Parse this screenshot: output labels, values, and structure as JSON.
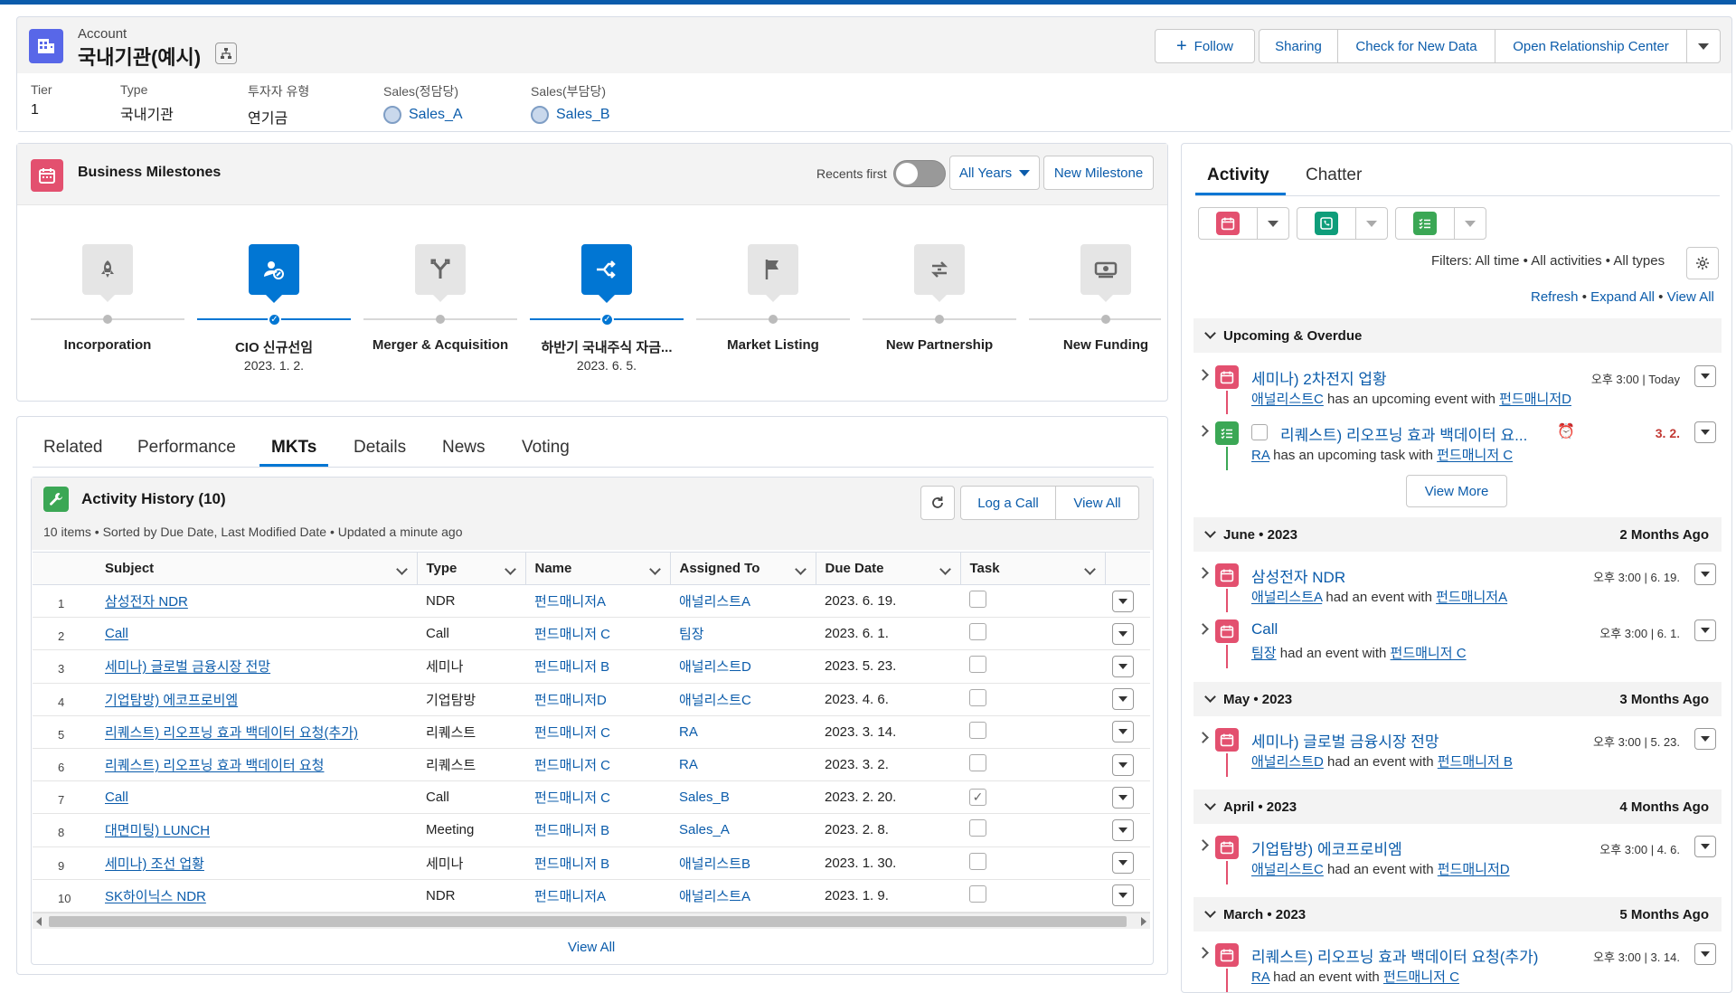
{
  "header": {
    "object_label": "Account",
    "record_name": "국내기관(예시)",
    "buttons": {
      "follow": "Follow",
      "sharing": "Sharing",
      "check_new_data": "Check for New Data",
      "open_relationship_center": "Open Relationship Center"
    },
    "fields": [
      {
        "label": "Tier",
        "value": "1"
      },
      {
        "label": "Type",
        "value": "국내기관"
      },
      {
        "label": "투자자 유형",
        "value": "연기금"
      },
      {
        "label": "Sales(정담당)",
        "value": "Sales_A"
      },
      {
        "label": "Sales(부담당)",
        "value": "Sales_B"
      }
    ]
  },
  "milestones": {
    "title": "Business Milestones",
    "recents_first_label": "Recents first",
    "recents_first_on": false,
    "years_filter": "All Years",
    "new_button": "New Milestone",
    "items": [
      {
        "label": "Incorporation",
        "date": "",
        "active": false,
        "icon": "rocket-icon"
      },
      {
        "label": "CIO 신규선임",
        "date": "2023. 1. 2.",
        "active": true,
        "icon": "user-edit-icon"
      },
      {
        "label": "Merger & Acquisition",
        "date": "",
        "active": false,
        "icon": "merge-icon"
      },
      {
        "label": "하반기 국내주식 자금...",
        "date": "2023. 6. 5.",
        "active": true,
        "icon": "split-arrows-icon"
      },
      {
        "label": "Market Listing",
        "date": "",
        "active": false,
        "icon": "flag-icon"
      },
      {
        "label": "New Partnership",
        "date": "",
        "active": false,
        "icon": "swap-icon"
      },
      {
        "label": "New Funding",
        "date": "",
        "active": false,
        "icon": "cash-icon"
      }
    ]
  },
  "tabs": [
    "Related",
    "Performance",
    "MKTs",
    "Details",
    "News",
    "Voting"
  ],
  "active_tab": "MKTs",
  "activity_history": {
    "title": "Activity History (10)",
    "subtitle": "10 items • Sorted by Due Date, Last Modified Date • Updated a minute ago",
    "log_call": "Log a Call",
    "view_all": "View All",
    "footer_view_all": "View All",
    "columns": [
      "Subject",
      "Type",
      "Name",
      "Assigned To",
      "Due Date",
      "Task"
    ],
    "rows": [
      {
        "n": "1",
        "subject": "삼성전자 NDR",
        "type": "NDR",
        "name": "펀드매니저A",
        "assigned": "애널리스트A",
        "due": "2023. 6. 19.",
        "task": false
      },
      {
        "n": "2",
        "subject": "Call",
        "type": "Call",
        "name": "펀드매니저 C",
        "assigned": "팀장",
        "due": "2023. 6. 1.",
        "task": false
      },
      {
        "n": "3",
        "subject": "세미나) 글로벌 금융시장 전망",
        "type": "세미나",
        "name": "펀드매니저 B",
        "assigned": "애널리스트D",
        "due": "2023. 5. 23.",
        "task": false
      },
      {
        "n": "4",
        "subject": "기업탐방) 에코프로비엠",
        "type": "기업탐방",
        "name": "펀드매니저D",
        "assigned": "애널리스트C",
        "due": "2023. 4. 6.",
        "task": false
      },
      {
        "n": "5",
        "subject": "리퀘스트) 리오프닝 효과 백데이터 요청(추가)",
        "type": "리퀘스트",
        "name": "펀드매니저 C",
        "assigned": "RA",
        "due": "2023. 3. 14.",
        "task": false
      },
      {
        "n": "6",
        "subject": "리퀘스트) 리오프닝 효과 백데이터 요청",
        "type": "리퀘스트",
        "name": "펀드매니저 C",
        "assigned": "RA",
        "due": "2023. 3. 2.",
        "task": false
      },
      {
        "n": "7",
        "subject": "Call",
        "type": "Call",
        "name": "펀드매니저 C",
        "assigned": "Sales_B",
        "due": "2023. 2. 20.",
        "task": true
      },
      {
        "n": "8",
        "subject": "대면미팅) LUNCH",
        "type": "Meeting",
        "name": "펀드매니저 B",
        "assigned": "Sales_A",
        "due": "2023. 2. 8.",
        "task": false
      },
      {
        "n": "9",
        "subject": "세미나) 조선 업황",
        "type": "세미나",
        "name": "펀드매니저 B",
        "assigned": "애널리스트B",
        "due": "2023. 1. 30.",
        "task": false
      },
      {
        "n": "10",
        "subject": "SK하이닉스 NDR",
        "type": "NDR",
        "name": "펀드매니저A",
        "assigned": "애널리스트A",
        "due": "2023. 1. 9.",
        "task": false
      }
    ]
  },
  "activity": {
    "tabs": [
      "Activity",
      "Chatter"
    ],
    "filters_text": "Filters: All time • All activities • All types",
    "refresh": "Refresh",
    "expand_all": "Expand All",
    "view_all": "View All",
    "view_more": "View More",
    "upcoming_title": "Upcoming & Overdue",
    "upcoming": [
      {
        "subject": "세미나) 2차전지 업황",
        "who": "애널리스트C",
        "verb": "has an upcoming event with",
        "whom": "펀드매니저D",
        "time": "오후 3:00 | Today",
        "kind": "event"
      },
      {
        "subject": "리퀘스트) 리오프닝 효과 백데이터 요...",
        "who": "RA",
        "verb": "has an upcoming task with",
        "whom": "펀드매니저 C",
        "time": "3. 2.",
        "kind": "task"
      }
    ],
    "groups": [
      {
        "title": "June • 2023",
        "ago": "2 Months Ago",
        "items": [
          {
            "subject": "삼성전자 NDR",
            "who": "애널리스트A",
            "verb": "had an event with",
            "whom": "펀드매니저A",
            "time": "오후 3:00 | 6. 19."
          },
          {
            "subject": "Call",
            "who": "팀장",
            "verb": "had an event with",
            "whom": "펀드매니저 C",
            "time": "오후 3:00 | 6. 1."
          }
        ]
      },
      {
        "title": "May • 2023",
        "ago": "3 Months Ago",
        "items": [
          {
            "subject": "세미나) 글로벌 금융시장 전망",
            "who": "애널리스트D",
            "verb": "had an event with",
            "whom": "펀드매니저 B",
            "time": "오후 3:00 | 5. 23."
          }
        ]
      },
      {
        "title": "April • 2023",
        "ago": "4 Months Ago",
        "items": [
          {
            "subject": "기업탐방) 에코프로비엠",
            "who": "애널리스트C",
            "verb": "had an event with",
            "whom": "펀드매니저D",
            "time": "오후 3:00 | 4. 6."
          }
        ]
      },
      {
        "title": "March • 2023",
        "ago": "5 Months Ago",
        "items": [
          {
            "subject": "리퀘스트) 리오프닝 효과 백데이터 요청(추가)",
            "who": "RA",
            "verb": "had an event with",
            "whom": "펀드매니저 C",
            "time": "오후 3:00 | 3. 14."
          }
        ]
      }
    ]
  },
  "colors": {
    "brand": "#0b5cab",
    "active_blue": "#0176d3",
    "event_pink": "#e3506f",
    "task_green": "#3ba755",
    "call_teal": "#0f9d7a",
    "account_purple": "#5867e8",
    "overdue_red": "#c23934"
  }
}
